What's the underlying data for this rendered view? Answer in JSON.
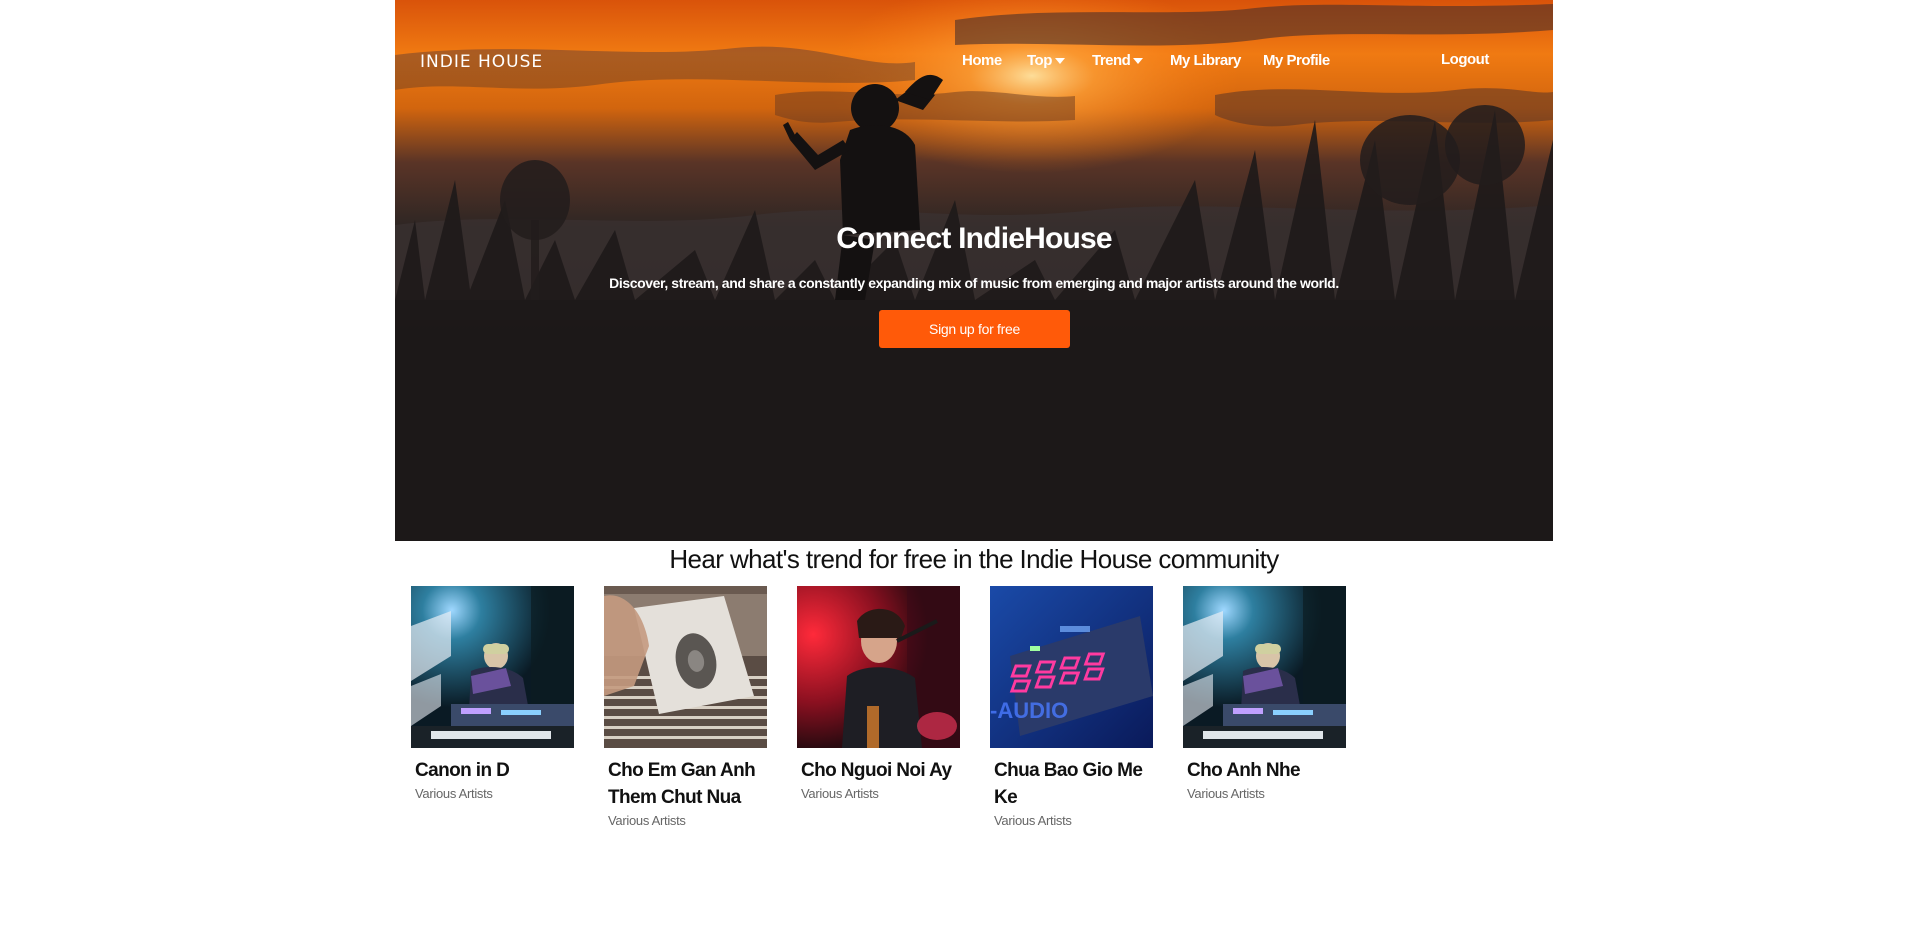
{
  "header": {
    "brand": "INDIE HOUSE",
    "nav": {
      "home": "Home",
      "top": "Top",
      "trend": "Trend",
      "library": "My Library",
      "profile": "My Profile",
      "logout": "Logout"
    }
  },
  "hero": {
    "title": "Connect IndieHouse",
    "subtitle": "Discover, stream, and share a constantly expanding mix of music from emerging and major artists around the world.",
    "cta": "Sign up for free"
  },
  "trending": {
    "heading": "Hear what's trend for free in the Indie House community",
    "tracks": [
      {
        "title": "Canon in D",
        "artist": "Various Artists"
      },
      {
        "title": "Cho Em Gan Anh Them Chut Nua",
        "artist": "Various Artists"
      },
      {
        "title": "Cho Nguoi Noi Ay",
        "artist": "Various Artists"
      },
      {
        "title": "Chua Bao Gio Me Ke",
        "artist": "Various Artists"
      },
      {
        "title": "Cho Anh Nhe",
        "artist": "Various Artists"
      }
    ]
  },
  "colors": {
    "accent": "#ff5a09",
    "hero_dark": "#1c1919",
    "sky_orange": "#f07a12"
  }
}
